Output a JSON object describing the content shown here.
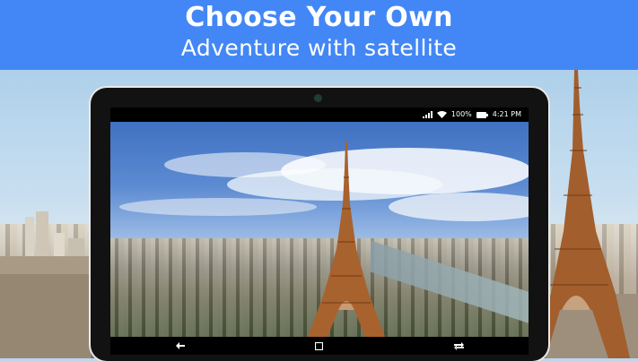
{
  "header": {
    "title": "Choose Your Own",
    "subtitle": "Adventure with satellite"
  },
  "device": {
    "status_bar": {
      "battery_percent": "100%",
      "time": "4:21 PM",
      "icons": [
        "signal-icon",
        "wifi-icon",
        "battery-icon"
      ]
    },
    "screen_image": "eiffel-tower-aerial-photo",
    "nav_bar": {
      "buttons": [
        "back-icon",
        "home-icon",
        "recent-apps-icon"
      ]
    }
  },
  "background_image": "paris-skyline-with-eiffel-tower",
  "colors": {
    "header_bg": "#4287f5",
    "tablet_frame": "#121212"
  }
}
